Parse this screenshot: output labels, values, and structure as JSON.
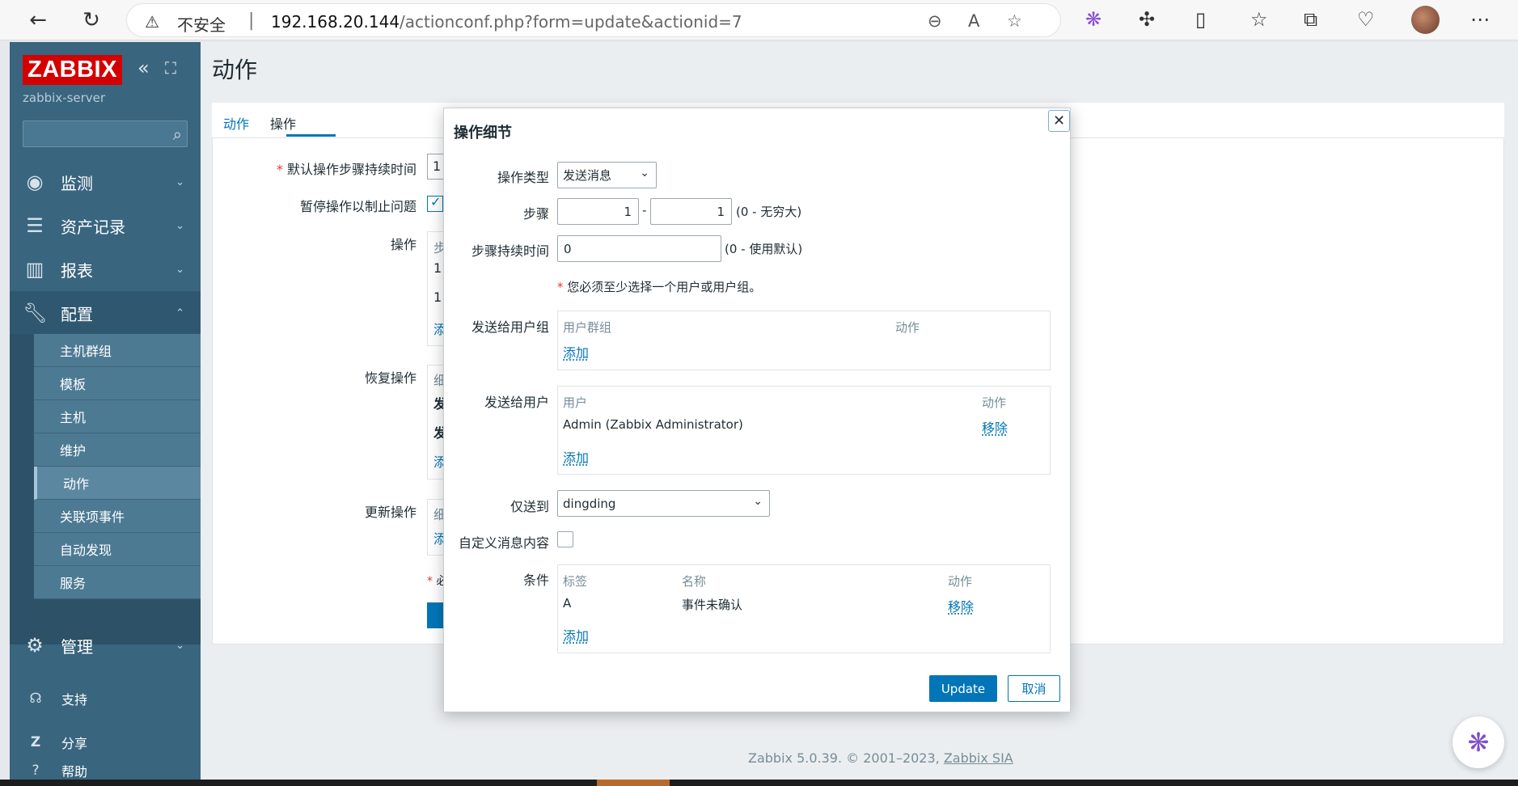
{
  "browser": {
    "back_icon": "back-arrow-icon",
    "insecure_label": "不安全",
    "url_host": "192.168.20.144",
    "url_path": "/actionconf.php?form=update&actionid=7"
  },
  "sidebar": {
    "logo": "ZABBIX",
    "server_name": "zabbix-server",
    "search_placeholder": "",
    "menu": [
      {
        "label": "监测",
        "icon": "eye-icon"
      },
      {
        "label": "资产记录",
        "icon": "list-icon"
      },
      {
        "label": "报表",
        "icon": "bar-chart-icon"
      },
      {
        "label": "配置",
        "icon": "wrench-icon"
      },
      {
        "label": "管理",
        "icon": "gear-icon"
      }
    ],
    "submenu": [
      "主机群组",
      "模板",
      "主机",
      "维护",
      "动作",
      "关联项事件",
      "自动发现",
      "服务"
    ],
    "bottom": [
      {
        "label": "支持",
        "icon": "headset-icon"
      },
      {
        "label": "分享",
        "icon": "share-icon"
      },
      {
        "label": "帮助",
        "icon": "help-icon"
      }
    ]
  },
  "main": {
    "title": "动作",
    "tabs": [
      "动作",
      "操作"
    ],
    "labels": {
      "default_duration": "默认操作步骤持续时间",
      "pause": "暂停操作以制止问题",
      "operations": "操作",
      "recovery": "恢复操作",
      "update": "更新操作"
    },
    "frag_duration": "1",
    "frag_step": "步",
    "frag_row1": "1",
    "frag_row2": "1",
    "frag_add": "添",
    "frag_group": "细",
    "frag_send1": "发",
    "frag_send2": "发",
    "frag_req": "必"
  },
  "modal": {
    "title": "操作细节",
    "close_icon": "close-icon",
    "op_type_label": "操作类型",
    "op_type_value": "发送消息",
    "steps_label": "步骤",
    "step_from": "1",
    "step_dash": "-",
    "step_to": "1",
    "steps_hint": "(0 - 无穷大)",
    "duration_label": "步骤持续时间",
    "duration_value": "0",
    "duration_hint": "(0 - 使用默认)",
    "required_note": "您必须至少选择一个用户或用户组。",
    "user_groups_label": "发送给用户组",
    "user_groups_headers": [
      "用户群组",
      "动作"
    ],
    "user_groups_add": "添加",
    "users_label": "发送给用户",
    "users_headers": [
      "用户",
      "动作"
    ],
    "users_rows": [
      {
        "name": "Admin (Zabbix Administrator)",
        "action": "移除"
      }
    ],
    "users_add": "添加",
    "send_only_label": "仅送到",
    "send_only_value": "dingding",
    "custom_msg_label": "自定义消息内容",
    "conditions_label": "条件",
    "conditions_headers": [
      "标签",
      "名称",
      "动作"
    ],
    "conditions_rows": [
      {
        "label": "A",
        "name": "事件未确认",
        "action": "移除"
      }
    ],
    "conditions_add": "添加",
    "update_button": "Update",
    "cancel_button": "取消"
  },
  "footer": {
    "text": "Zabbix 5.0.39. © 2001–2023, ",
    "link": "Zabbix SIA"
  },
  "colors": {
    "accent": "#0275b8",
    "sidebar": "#39657f",
    "logo": "#d40000"
  }
}
